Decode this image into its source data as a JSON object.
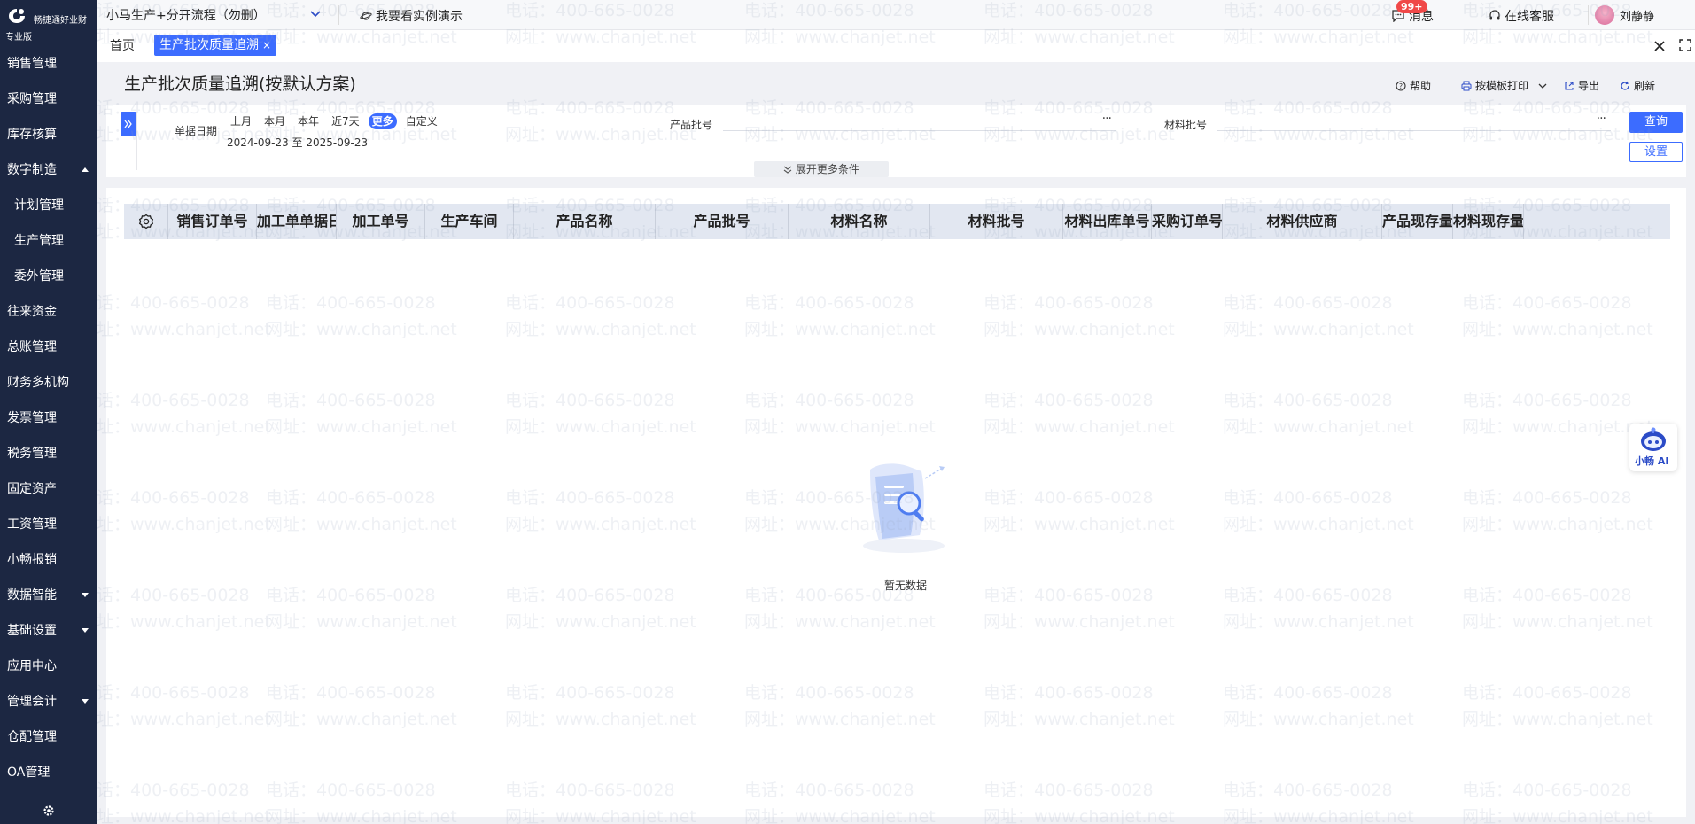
{
  "app": {
    "brand": "畅捷通好业财",
    "edition": "专业版",
    "company": "小马生产+分开流程（勿删）",
    "demo_link": "我要看实例演示",
    "messages_label": "消息",
    "messages_badge": "99+",
    "service_label": "在线客服",
    "user_name": "刘静静"
  },
  "sidebar": {
    "items": [
      {
        "label": "销售管理"
      },
      {
        "label": "采购管理"
      },
      {
        "label": "库存核算"
      },
      {
        "label": "数字制造"
      },
      {
        "label": "计划管理"
      },
      {
        "label": "生产管理"
      },
      {
        "label": "委外管理"
      },
      {
        "label": "往来资金"
      },
      {
        "label": "总账管理"
      },
      {
        "label": "财务多机构"
      },
      {
        "label": "发票管理"
      },
      {
        "label": "税务管理"
      },
      {
        "label": "固定资产"
      },
      {
        "label": "工资管理"
      },
      {
        "label": "小畅报销"
      },
      {
        "label": "数据智能"
      },
      {
        "label": "基础设置"
      },
      {
        "label": "应用中心"
      },
      {
        "label": "管理会计"
      },
      {
        "label": "仓配管理"
      },
      {
        "label": "OA管理"
      }
    ]
  },
  "tabs": {
    "home": "首页",
    "active": "生产批次质量追溯",
    "close_glyph": "×"
  },
  "page": {
    "title": "生产批次质量追溯(按默认方案)",
    "actions": {
      "help": "帮助",
      "print": "按模板打印",
      "export": "导出",
      "refresh": "刷新"
    }
  },
  "filter": {
    "date_label": "单据日期",
    "quick_options": [
      "上月",
      "本月",
      "本年",
      "近7天",
      "更多",
      "自定义"
    ],
    "quick_selected": "更多",
    "date_range": "2024-09-23 至 2025-09-23",
    "product_batch_label": "产品批号",
    "product_batch_value": "",
    "material_batch_label": "材料批号",
    "material_batch_value": "",
    "query_button": "查询",
    "settings_button": "设置",
    "expand_more": "展开更多条件"
  },
  "table": {
    "columns": [
      "销售订单号",
      "加工单单据日期",
      "加工单号",
      "生产车间",
      "产品名称",
      "产品批号",
      "材料名称",
      "材料批号",
      "材料出库单号",
      "采购订单号",
      "材料供应商",
      "产品现存量",
      "材料现存量"
    ],
    "rows": [],
    "empty_text": "暂无数据"
  },
  "watermark": {
    "phone": "电话：400-665-0028",
    "site": "网址：www.chanjet.net"
  },
  "ai_assistant": {
    "label": "小畅 AI"
  },
  "colors": {
    "sidebar_bg": "#1c2742",
    "accent": "#3c6cff",
    "badge": "#f04848",
    "table_header_bg": "#e2e7f1"
  }
}
